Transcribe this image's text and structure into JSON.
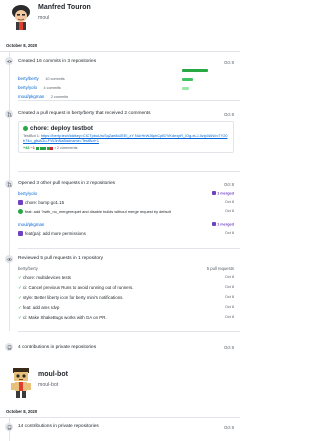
{
  "users": [
    {
      "name": "Manfred Touron",
      "login": "moul",
      "date": "October 8, 2020"
    },
    {
      "name": "moul-bot",
      "login": "moul-bot",
      "date": "October 8, 2020"
    }
  ],
  "commits": {
    "title": "Created 16 commits in 3 repositories",
    "when": "Oct 8",
    "repos": [
      {
        "name": "berty/berty",
        "count": "10 commits",
        "fraction": 1.0
      },
      {
        "name": "berty/yolo",
        "count": "4 commits",
        "fraction": 0.4
      },
      {
        "name": "moul/pkgman",
        "count": "2 commits",
        "fraction": 0.2
      }
    ]
  },
  "pull_request": {
    "title_prefix": "Created a pull request in ",
    "repo": "berty/berty",
    "title_suffix": " that received 2 comments",
    "when": "Oct 8",
    "pr_title": "chore: deploy testbot",
    "body_label": "TestBot 1: ",
    "body_link": "https://berty.tech/id#key=CiCTpbuUruSqZae8dJEEl_zY NUrHrWJ6pbCpB7VKdnxpR_IOg-eLJ-0zlp0AN/rcTY20bT4o_gfsAGu-FVk3nNaBa#name=TestBot+1",
    "additions": "+48",
    "deletions": "−1",
    "comments": "• 2 comments"
  },
  "opened_prs": {
    "title": "Opened 3 other pull requests in 2 repositories",
    "when": "Oct 8",
    "groups": [
      {
        "repo": "berty/yolo",
        "badge": "1 merged",
        "items": [
          {
            "title": "chore: bump go1.15",
            "status": "merged",
            "date": "Oct 8"
          },
          {
            "title": "feat: add ?with_no_mergerequet and disable builds without merge request by default",
            "status": "",
            "date": "Oct 8"
          }
        ]
      },
      {
        "repo": "moul/pkgman",
        "badge": "1 merged",
        "items": [
          {
            "title": "feat(pa): add more permissions",
            "status": "merged",
            "date": "Oct 8"
          }
        ]
      }
    ]
  },
  "reviews": {
    "title": "Reviewed 5 pull requests in 1 repository",
    "when": "",
    "repo": "berty/berty",
    "count": "5 pull requests",
    "items": [
      {
        "title": "chore: multidevices tests",
        "date": "Oct 8"
      },
      {
        "title": "ci: Cancel previous Runs to avoid running out of runners.",
        "date": "Oct 8"
      },
      {
        "title": "style: Better liberty icon for berty mini's notifications.",
        "date": "Oct 8"
      },
      {
        "title": "feat: add ams rdvp",
        "date": "Oct 8"
      },
      {
        "title": "ci: Make ShakeBugs works with GA on PR.",
        "date": "Oct 8"
      }
    ]
  },
  "private_1": {
    "title": "4 contributions in private repositories",
    "when": "Oct 8"
  },
  "private_2": {
    "title": "14 contributions in private repositories",
    "when": "Oct 8"
  },
  "colors": {
    "link": "#0366d6",
    "commit_bar": "#28a745",
    "merged": "#6f42c1",
    "muted": "#586069"
  }
}
